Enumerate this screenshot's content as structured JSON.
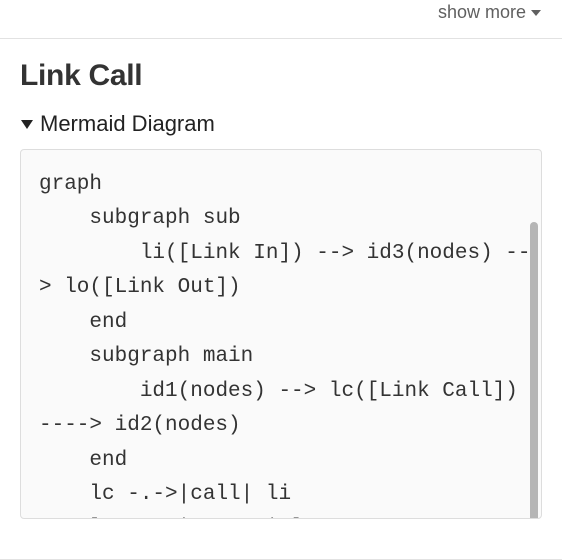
{
  "header": {
    "show_more_label": "show more"
  },
  "section": {
    "title": "Link Call",
    "summary_label": "Mermaid Diagram"
  },
  "code": {
    "text": "graph\n    subgraph sub\n        li([Link In]) --> id3(nodes) --> lo([Link Out])\n    end\n    subgraph main\n        id1(nodes) --> lc([Link Call]) ----> id2(nodes)\n    end\n    lc -.->|call| li\n    lo -.->|return| lc"
  }
}
